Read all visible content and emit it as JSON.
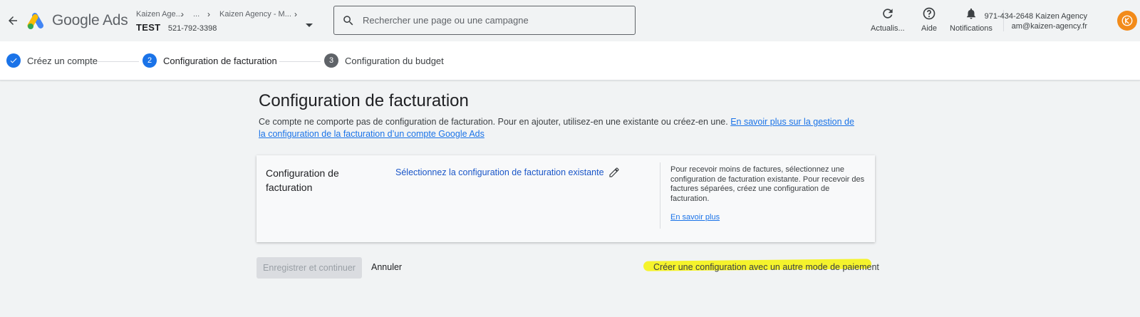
{
  "header": {
    "brand": "Google Ads",
    "breadcrumb": {
      "manager": "Kaizen Age...",
      "middle": "...",
      "account": "Kaizen Agency - M..."
    },
    "account_name": "TEST",
    "account_id": "521-792-3398",
    "search_placeholder": "Rechercher une page ou une campagne",
    "tools": {
      "refresh": "Actualis...",
      "help": "Aide",
      "notifications": "Notifications"
    },
    "user": {
      "line1": "971-434-2648 Kaizen Agency",
      "line2": "am@kaizen-agency.fr"
    }
  },
  "stepper": {
    "steps": [
      {
        "label": "Créez un compte",
        "state": "done"
      },
      {
        "number": "2",
        "label": "Configuration de facturation",
        "state": "active"
      },
      {
        "number": "3",
        "label": "Configuration du budget",
        "state": "pending"
      }
    ]
  },
  "main": {
    "title": "Configuration de facturation",
    "description": "Ce compte ne comporte pas de configuration de facturation. Pour en ajouter, utilisez-en une existante ou créez-en une. ",
    "learn_more_link": "En savoir plus sur la gestion de la configuration de la facturation d’un compte Google Ads",
    "card": {
      "label": "Configuration de facturation",
      "select_link": "Sélectionnez la configuration de facturation existante",
      "help_text": "Pour recevoir moins de factures, sélectionnez une configuration de facturation existante. Pour recevoir des factures séparées, créez une configuration de facturation.",
      "help_link": "En savoir plus"
    },
    "actions": {
      "save": "Enregistrer et continuer",
      "cancel": "Annuler",
      "alternate": "Créer une configuration avec un autre mode de paiement"
    }
  },
  "colors": {
    "accent": "#1a73e8",
    "step_pending": "#5f6368",
    "highlight": "#f4f221",
    "avatar": "#f28b1a"
  }
}
